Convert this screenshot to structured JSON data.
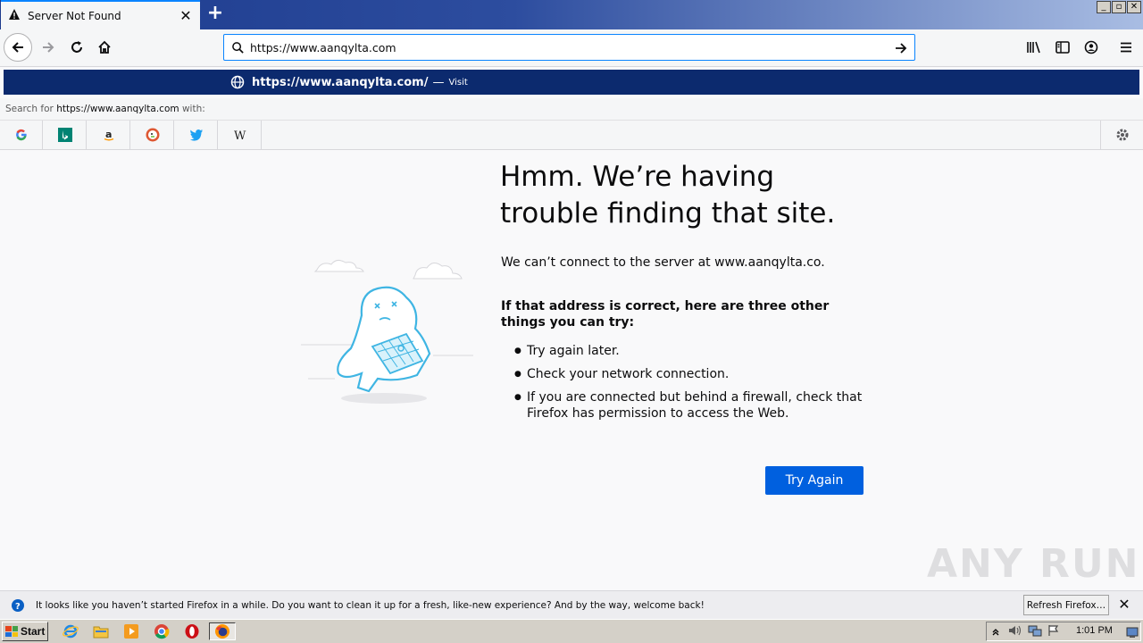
{
  "tab": {
    "title": "Server Not Found",
    "close": "✕"
  },
  "window": {
    "new_tab": "+",
    "minimize": "_",
    "restore": "▫",
    "close": "✕"
  },
  "urlbar": {
    "value": "https://www.aanqylta.com"
  },
  "suggestion": {
    "url": "https://www.aanqylta.com/",
    "dash": "—",
    "action": "Visit"
  },
  "search_for": {
    "prefix": "Search for ",
    "query": "https://www.aanqylta.com",
    "suffix": " with:"
  },
  "engines": [
    "google-icon",
    "bing-icon",
    "amazon-icon",
    "duckduckgo-icon",
    "twitter-icon",
    "wikipedia-icon"
  ],
  "error": {
    "title": "Hmm. We’re having trouble finding that site.",
    "description": "We can’t connect to the server at www.aanqylta.co.",
    "subtitle": "If that address is correct, here are three other things you can try:",
    "items": [
      "Try again later.",
      "Check your network connection.",
      "If you are connected but behind a firewall, check that Firefox has permission to access the Web."
    ],
    "button": "Try Again"
  },
  "notification": {
    "text": "It looks like you haven’t started Firefox in a while. Do you want to clean it up for a fresh, like-new experience? And by the way, welcome back!",
    "button": "Refresh Firefox…",
    "close": "✕"
  },
  "watermark": "ANY RUN",
  "taskbar": {
    "start": "Start",
    "clock": "1:01 PM"
  },
  "colors": {
    "accent": "#0a84ff",
    "button": "#0060df",
    "suggestion_bg": "#0c2a6e"
  }
}
